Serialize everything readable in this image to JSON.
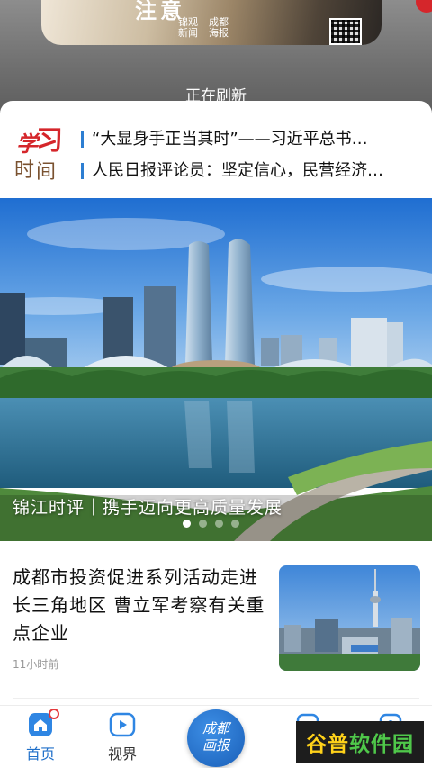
{
  "refresh": {
    "status_text": "正在刷新",
    "banner_word": "注意",
    "banner_brand": [
      "锦观新闻",
      "成都海报"
    ]
  },
  "headlines": [
    "“大显身手正当其时”——习近平总书…",
    "人民日报评论员：坚定信心，民营经济…"
  ],
  "section_logo": "学习时间",
  "hero": {
    "caption": "锦江时评｜携手迈向更高质量发展",
    "dot_count": 4,
    "active_index": 0
  },
  "article": {
    "title": "成都市投资促进系列活动走进长三角地区 曹立军考察有关重点企业",
    "time": "11小时前"
  },
  "tabs": [
    {
      "label": "首页",
      "icon": "home-icon",
      "active": true
    },
    {
      "label": "视界",
      "icon": "play-icon",
      "active": false
    },
    {
      "label": "成都画报",
      "icon": "center-logo-icon",
      "active": false
    },
    {
      "label": "",
      "icon": "tab4-icon",
      "active": false
    },
    {
      "label": "",
      "icon": "user-icon",
      "active": false
    }
  ],
  "watermark": {
    "part_a": "谷普",
    "part_b": "软件园"
  },
  "colors": {
    "accent": "#1f6fc9",
    "headline_bar": "#2d7ed2",
    "logo_red": "#d5262b"
  }
}
